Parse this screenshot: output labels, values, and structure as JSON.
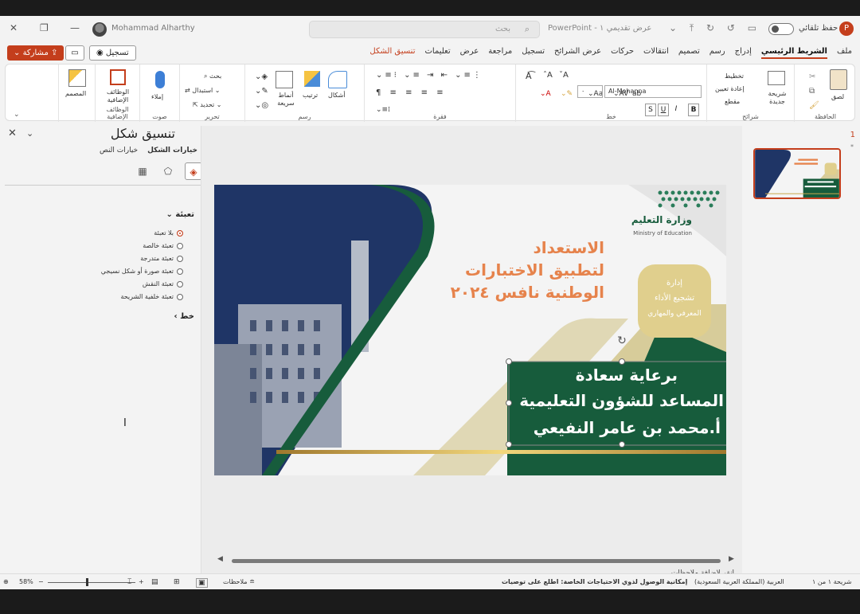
{
  "titlebar": {
    "username": "Mohammad Alharthy",
    "search_placeholder": "بحث",
    "doc_title": "PowerPoint - عرض تقديمي ١",
    "autosave": "حفظ تلقائي",
    "app_logo": "P"
  },
  "tabs": {
    "share": "مشاركة",
    "record": "تسجيل",
    "items": [
      "ملف",
      "الشريط الرئيسي",
      "إدراج",
      "رسم",
      "تصميم",
      "انتقالات",
      "حركات",
      "عرض الشرائح",
      "تسجيل",
      "مراجعة",
      "عرض",
      "تعليمات",
      "تنسيق الشكل"
    ],
    "active_index": 1,
    "contextual_index": 12
  },
  "ribbon": {
    "clipboard": {
      "paste": "لصق",
      "group": "الحافظة"
    },
    "slides": {
      "new_slide": "شريحة جديدة",
      "layout": "تخطيط",
      "reset": "إعادة تعيين",
      "section": "مقطع",
      "group": "شرائح"
    },
    "font": {
      "name": "Al-Mohanna",
      "size": "٠",
      "group": "خط"
    },
    "paragraph": {
      "group": "فقرة"
    },
    "drawing": {
      "shapes": "أشكال",
      "arrange": "ترتيب",
      "quick_styles": "أنماط سريعة",
      "group": "رسم"
    },
    "editing": {
      "find": "بحث",
      "replace": "استبدال",
      "select": "تحديد",
      "group": "تحرير"
    },
    "voice": {
      "dictate": "إملاء",
      "group": "صوت"
    },
    "addins": {
      "label": "الوظائف الإضافية",
      "group": "الوظائف الإضافية"
    },
    "designer": {
      "label": "المصمم"
    }
  },
  "pane": {
    "title": "تنسيق شكل",
    "subtabs": [
      "خيارات الشكل",
      "خيارات النص"
    ],
    "fill_section": "تعبئة",
    "fill_options": [
      "بلا تعبئة",
      "تعبئة خالصة",
      "تعبئة متدرجة",
      "تعبئة صورة أو شكل نسيجي",
      "تعبئة النقش",
      "تعبئة خلفية الشريحة"
    ],
    "selected_fill": 0,
    "line_section": "خط"
  },
  "slide": {
    "ministry_ar": "وزارة التعليم",
    "ministry_en": "Ministry of Education",
    "heading_lines": [
      "الاستعداد",
      "لتطبيق الاختبارات",
      "الوطنية نافس ٢٠٢٤"
    ],
    "badge_lines": [
      "إدارة",
      "تشجيع الأداء",
      "المعرفي والمهاري"
    ],
    "patron_lines": [
      "برعاية سعادة",
      "المساعد للشؤون التعليمية",
      "أ.محمد بن عامر النفيعي"
    ]
  },
  "notes_placeholder": "انقر لإضافة ملاحظات",
  "thumbs": {
    "slide_number": "1",
    "star": "*"
  },
  "status": {
    "slide_count": "شريحة ١ من ١",
    "language": "العربية (المملكة العربية السعودية)",
    "accessibility": "إمكانية الوصول لذوي الاحتياجات الخاصة: اطلع على توصيات",
    "notes": "ملاحظات",
    "zoom": "58%"
  },
  "colors": {
    "brand": "#c43e1c",
    "navy": "#1f3566",
    "green": "#175c3c",
    "gold": "#c9b87b",
    "orange": "#e6834c"
  }
}
